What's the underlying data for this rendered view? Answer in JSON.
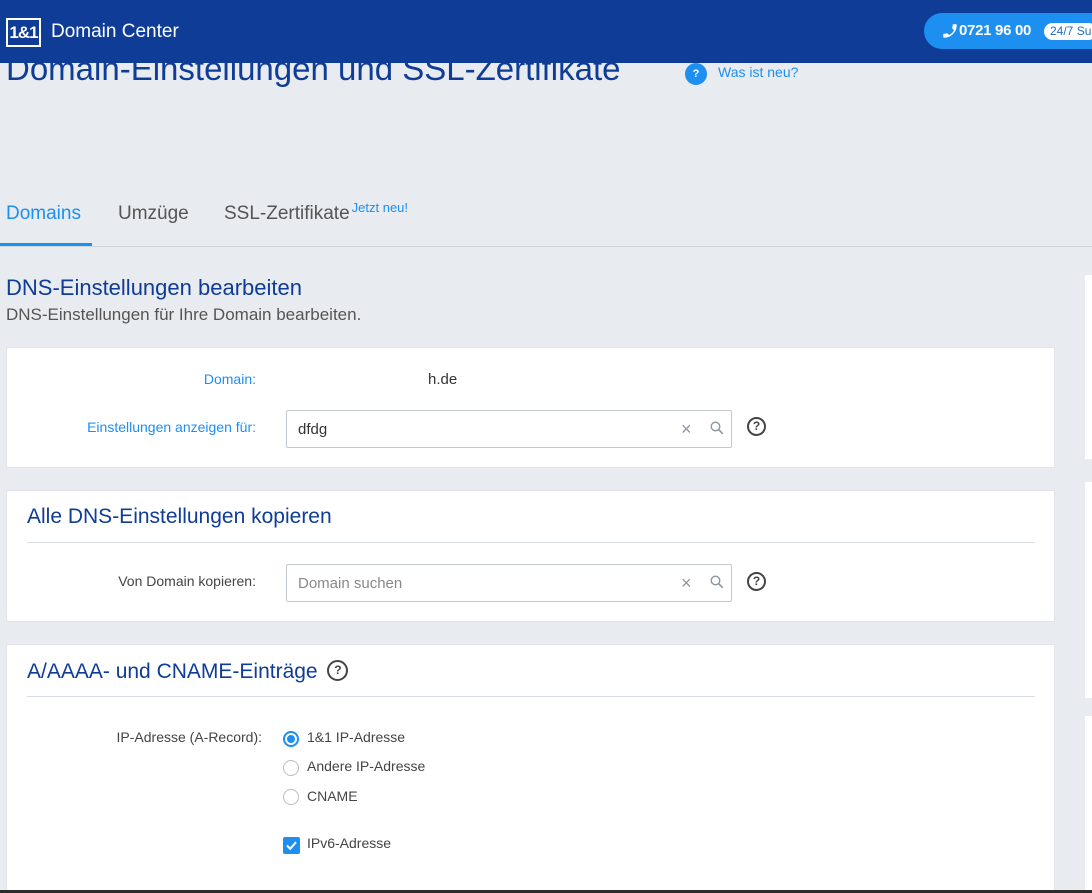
{
  "header": {
    "logo": "1&1",
    "brand": "Domain Center",
    "phone_number": "0721 96 00",
    "hours_badge": "24/7 Su"
  },
  "page": {
    "title": "Domain-Einstellungen und SSL-Zertifikate",
    "whats_new_icon": "?",
    "whats_new_link": "Was ist neu?"
  },
  "tabs": [
    {
      "label": "Domains",
      "active": true
    },
    {
      "label": "Umzüge",
      "active": false
    },
    {
      "label": "SSL-Zertifikate",
      "badge": "Jetzt neu!",
      "active": false
    }
  ],
  "dns_section": {
    "title": "DNS-Einstellungen bearbeiten",
    "subtitle": "DNS-Einstellungen für Ihre Domain bearbeiten."
  },
  "domain_card": {
    "domain_label": "Domain:",
    "domain_value": "h.de",
    "settings_label": "Einstellungen anzeigen für:",
    "settings_value": "dfdg",
    "help": "?"
  },
  "copy_card": {
    "title": "Alle DNS-Einstellungen kopieren",
    "from_label": "Von Domain kopieren:",
    "search_placeholder": "Domain suchen",
    "help": "?"
  },
  "records_card": {
    "title": "A/AAAA- und CNAME-Einträge",
    "help": "?",
    "ip_label": "IP-Adresse (A-Record):",
    "options": [
      {
        "label": "1&1 IP-Adresse",
        "checked": true
      },
      {
        "label": "Andere IP-Adresse",
        "checked": false
      },
      {
        "label": "CNAME",
        "checked": false
      }
    ],
    "ipv6_label": "IPv6-Adresse",
    "ipv6_checked": true
  },
  "colors": {
    "brand_dark": "#0f3c96",
    "accent": "#1d8ff0",
    "background": "#e8ebef"
  },
  "icons": [
    "phone-icon",
    "help-circle-icon",
    "clear-icon",
    "search-icon",
    "radio-button-icon",
    "checkbox-icon"
  ]
}
